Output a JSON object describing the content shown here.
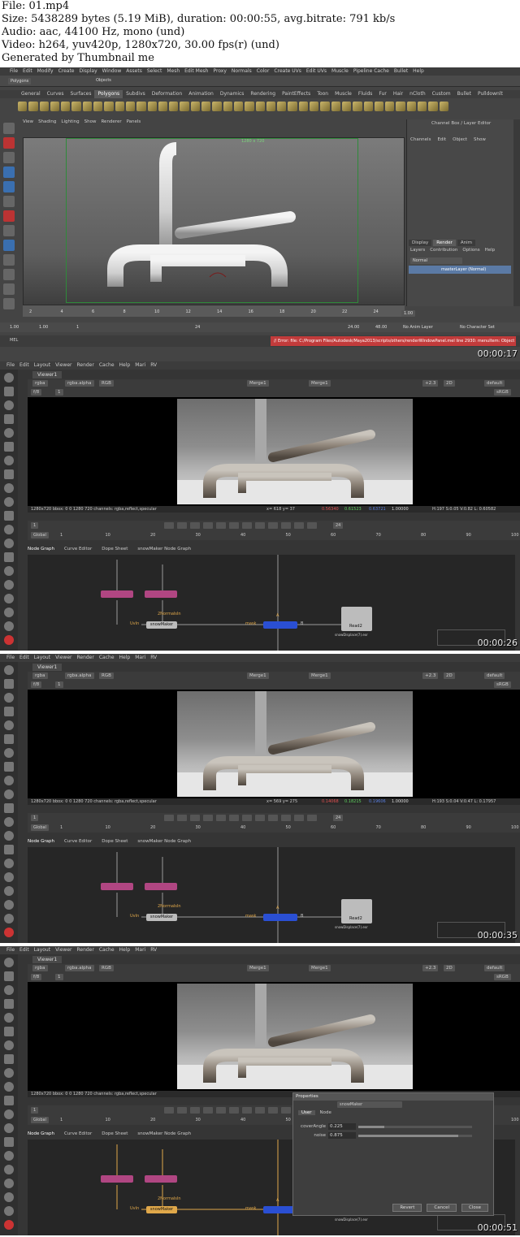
{
  "header": {
    "file": "File: 01.mp4",
    "size": "Size: 5438289 bytes (5.19 MiB), duration: 00:00:55, avg.bitrate: 791 kb/s",
    "audio": "Audio: aac, 44100 Hz, mono (und)",
    "video": "Video: h264, yuv420p, 1280x720, 30.00 fps(r) (und)",
    "generator": "Generated by Thumbnail me"
  },
  "maya": {
    "menu": [
      "File",
      "Edit",
      "Modify",
      "Create",
      "Display",
      "Window",
      "Assets",
      "Select",
      "Mesh",
      "Edit Mesh",
      "Proxy",
      "Normals",
      "Color",
      "Create UVs",
      "Edit UVs",
      "Muscle",
      "Pipeline Cache",
      "Bullet",
      "Help"
    ],
    "mode": "Polygons",
    "objects_label": "Objects",
    "shelf_tabs": [
      "General",
      "Curves",
      "Surfaces",
      "Polygons",
      "Subdivs",
      "Deformation",
      "Animation",
      "Dynamics",
      "Rendering",
      "PaintEffects",
      "Toon",
      "Muscle",
      "Fluids",
      "Fur",
      "Hair",
      "nCloth",
      "Custom",
      "Bullet",
      "Pulldownlt"
    ],
    "active_shelf": "Polygons",
    "viewport_menu": [
      "View",
      "Shading",
      "Lighting",
      "Show",
      "Renderer",
      "Panels"
    ],
    "resolution_label": "1280 x 720",
    "channel_box_title": "Channel Box / Layer Editor",
    "channel_menu": [
      "Channels",
      "Edit",
      "Object",
      "Show"
    ],
    "layer_tabs": [
      "Display",
      "Render",
      "Anim"
    ],
    "active_layer_tab": "Render",
    "layer_menu": [
      "Layers",
      "Contribution",
      "Options",
      "Help"
    ],
    "blend_mode": "Normal",
    "layer_name": "masterLayer (Normal)",
    "timeline_ticks": [
      "2",
      "4",
      "6",
      "8",
      "10",
      "12",
      "14",
      "16",
      "18",
      "20",
      "22",
      "24"
    ],
    "current_frame": "1.00",
    "range_start": "1.00",
    "range_start2": "1.00",
    "range_cur": "1",
    "range_end_in": "24",
    "range_end": "24.00",
    "range_end2": "48.00",
    "anim_layer": "No Anim Layer",
    "char_set": "No Character Set",
    "mel_label": "MEL",
    "error_text": "// Error: file: C:/Program Files/Autodesk/Maya2013/scripts/others/renderWindowPanel.mel line 2930: menuItem: Object 'renderVie",
    "timestamp": "00:00:17"
  },
  "nuke_frames": [
    {
      "timestamp": "00:00:26",
      "menu": [
        "File",
        "Edit",
        "Layout",
        "Viewer",
        "Render",
        "Cache",
        "Help",
        "Mari",
        "RV"
      ],
      "viewer_tab": "Viewer1",
      "channels": "rgba",
      "alpha": "rgba.alpha",
      "display": "RGB",
      "input_a": "Merge1",
      "input_b": "Merge1",
      "gain": "+2.3",
      "view_mode": "2D",
      "lut": "default",
      "colorspace": "sRGB",
      "fstop": "f/8",
      "frame": "1",
      "info": "1280x720 bbox: 0 0 1280 720 channels: rgba,reflect,specular",
      "coords": "x= 618 y= 37",
      "r": "0.56340",
      "g": "0.61523",
      "b": "0.63721",
      "a": "1.00000",
      "hsv": "H:197 S:0.05 V:0.82  L: 0.60582",
      "fps": "24",
      "global": "Global",
      "timeline_ticks": [
        "1",
        "10",
        "20",
        "30",
        "40",
        "50",
        "60",
        "70",
        "80",
        "90",
        "100"
      ],
      "panel_tabs": [
        "Node Graph",
        "Curve Editor",
        "Dope Sheet",
        "snowMaker Node Graph"
      ],
      "nodes": {
        "uv_label": "UvIn",
        "snow": "snowMaker",
        "normals": "2NormalsIn",
        "mask": "mask",
        "read": "Read2",
        "read_sub": "snowDisplace(7).exr",
        "a": "A",
        "b": "B"
      },
      "show_props": false
    },
    {
      "timestamp": "00:00:35",
      "menu": [
        "File",
        "Edit",
        "Layout",
        "Viewer",
        "Render",
        "Cache",
        "Help",
        "Mari",
        "RV"
      ],
      "viewer_tab": "Viewer1",
      "channels": "rgba",
      "alpha": "rgba.alpha",
      "display": "RGB",
      "input_a": "Merge1",
      "input_b": "Merge1",
      "gain": "+2.3",
      "view_mode": "2D",
      "lut": "default",
      "colorspace": "sRGB",
      "fstop": "f/8",
      "frame": "1",
      "info": "1280x720 bbox: 0 0 1280 720 channels: rgba,reflect,specular",
      "coords": "x= 569 y= 275",
      "r": "0.14068",
      "g": "0.18215",
      "b": "0.19606",
      "a": "1.00000",
      "hsv": "H:193 S:0.04 V:0.47  L: 0.17957",
      "fps": "24",
      "global": "Global",
      "timeline_ticks": [
        "1",
        "10",
        "20",
        "30",
        "40",
        "50",
        "60",
        "70",
        "80",
        "90",
        "100"
      ],
      "panel_tabs": [
        "Node Graph",
        "Curve Editor",
        "Dope Sheet",
        "snowMaker Node Graph"
      ],
      "nodes": {
        "uv_label": "UvIn",
        "snow": "snowMaker",
        "normals": "2NormalsIn",
        "mask": "mask",
        "read": "Read2",
        "read_sub": "snowDisplace(7).exr",
        "a": "A",
        "b": "B"
      },
      "show_props": false
    },
    {
      "timestamp": "00:00:51",
      "menu": [
        "File",
        "Edit",
        "Layout",
        "Viewer",
        "Render",
        "Cache",
        "Help",
        "Mari",
        "RV"
      ],
      "viewer_tab": "Viewer1",
      "channels": "rgba",
      "alpha": "rgba.alpha",
      "display": "RGB",
      "input_a": "Merge1",
      "input_b": "Merge1",
      "gain": "+2.3",
      "view_mode": "2D",
      "lut": "default",
      "colorspace": "sRGB",
      "fstop": "f/8",
      "frame": "1",
      "info": "1280x720 bbox: 0 0 1280 720 channels: rgba,reflect,specular",
      "coords": "",
      "r": "",
      "g": "",
      "b": "",
      "a": "",
      "hsv": "",
      "fps": "24",
      "global": "Global",
      "timeline_ticks": [
        "1",
        "10",
        "20",
        "30",
        "40",
        "50",
        "60",
        "70",
        "80",
        "90",
        "100"
      ],
      "panel_tabs": [
        "Node Graph",
        "Curve Editor",
        "Dope Sheet",
        "snowMaker Node Graph"
      ],
      "nodes": {
        "uv_label": "UvIn",
        "snow": "snowMaker",
        "normals": "2NormalsIn",
        "mask": "mask",
        "read": "Read2",
        "read_sub": "snowDisplace(7).exr",
        "a": "A",
        "b": "B"
      },
      "show_props": true,
      "props": {
        "title": "Properties",
        "node_name": "snowMaker",
        "tabs": [
          "User",
          "Node"
        ],
        "active_tab": "User",
        "knobs": [
          {
            "label": "coverAngle",
            "value": "0.225",
            "fraction": 0.225
          },
          {
            "label": "noise",
            "value": "0.875",
            "fraction": 0.875
          }
        ],
        "buttons": [
          "Revert",
          "Cancel",
          "Close"
        ]
      }
    }
  ],
  "colors": {
    "maya_bg": "#444444",
    "nuke_bg": "#353535",
    "error_bar": "#c23b3b",
    "node_pink": "#b04682",
    "node_blue": "#2a4fd3",
    "node_orange": "#e0a84a",
    "gate_green": "#2f8a3a"
  }
}
